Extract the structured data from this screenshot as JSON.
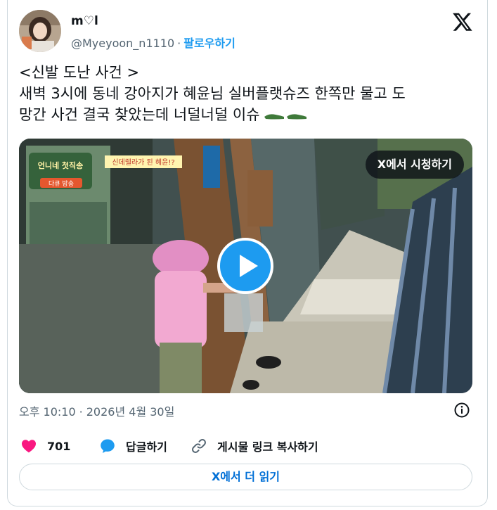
{
  "author": {
    "display_name": "m♡l",
    "handle": "@Myeyoon_n1110",
    "follow_label": "팔로우하기",
    "separator": "·"
  },
  "tweet": {
    "line1": "<신발 도난 사건 >",
    "line2": "새벽 3시에 동네 강아지가 혜윤님 실버플랫슈즈 한쪽만 물고 도",
    "line3": "망간 사건 결국 찾았는데 너덜너덜 이슈"
  },
  "media": {
    "watch_label": "X에서 시청하기",
    "caption_badge": "신데렐라가 된 혜윤!?",
    "show_logo_text": "언니네 첫직송",
    "show_sub": "다큐 방송"
  },
  "meta": {
    "time": "오후 10:10",
    "separator": "·",
    "date": "2026년 4월 30일"
  },
  "actions": {
    "like_count": "701",
    "reply_label": "답글하기",
    "copy_link_label": "게시물 링크 복사하기"
  },
  "read_more": "X에서 더 읽기",
  "colors": {
    "accent": "#1d9bf0",
    "like": "#f91880",
    "muted": "#536471",
    "link": "#006fd6"
  },
  "icons": [
    "x-logo-icon",
    "play-icon",
    "info-icon",
    "heart-icon",
    "reply-icon",
    "link-icon",
    "flat-shoe-icon"
  ]
}
